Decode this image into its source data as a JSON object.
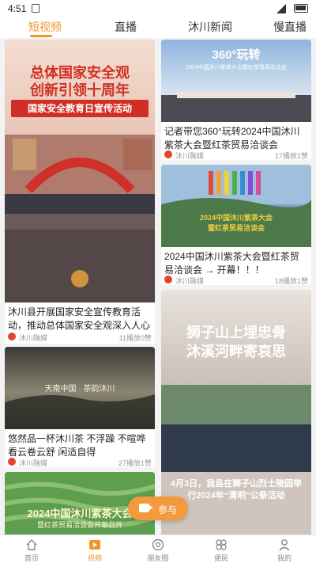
{
  "status": {
    "time": "4:51"
  },
  "tabs": [
    "短视频",
    "直播",
    "沐川新闻",
    "慢直播"
  ],
  "cards": {
    "left": [
      {
        "overlay_lines": [
          "总体国家安全观",
          "创新引领十周年"
        ],
        "overlay_banner": "国家安全教育日宣传活动",
        "title": "沐川县开展国家安全宣传教育活动，推动总体国家安全观深入人心",
        "source": "沐川融媒",
        "stats": "11播放0赞"
      },
      {
        "overlay_text": "天南中国 · 茶韵沐川",
        "title": "悠然品一杯沐川茶 不浮躁 不喧哗 看云卷云舒 闲适自得",
        "source": "沐川融媒",
        "stats": "27播放1赞"
      },
      {
        "overlay_lines": [
          "2024中国沐川紫茶大会",
          "暨红茶贸易洽谈会开幕召开"
        ]
      }
    ],
    "right": [
      {
        "overlay_top": "360°玩转",
        "overlay_sub": "2024中国沐川紫茶大会暨红茶贸易洽谈会",
        "title": "记者带您360°玩转2024中国沐川紫茶大会暨红茶贸易洽谈会",
        "source": "沐川融媒",
        "stats": "17播放1赞"
      },
      {
        "overlay_lines": [
          "2024中国沐川紫茶大会",
          "暨红茶贸易洽谈会"
        ],
        "title": "2024中国沐川紫茶大会暨红茶贸易洽谈会 → 开幕！！！",
        "source": "沐川融媒",
        "stats": "18播放1赞"
      },
      {
        "overlay_lines": [
          "狮子山上埋忠骨",
          "沐溪河畔寄哀思"
        ],
        "overlay_caption": "4月3日，我县在狮子山烈士陵园举行2024年“清明”公祭活动"
      }
    ]
  },
  "fab": {
    "label": "参与"
  },
  "nav": [
    "首页",
    "视频",
    "朋友圈",
    "便民",
    "我的"
  ],
  "colors": {
    "accent": "#f0962a"
  }
}
